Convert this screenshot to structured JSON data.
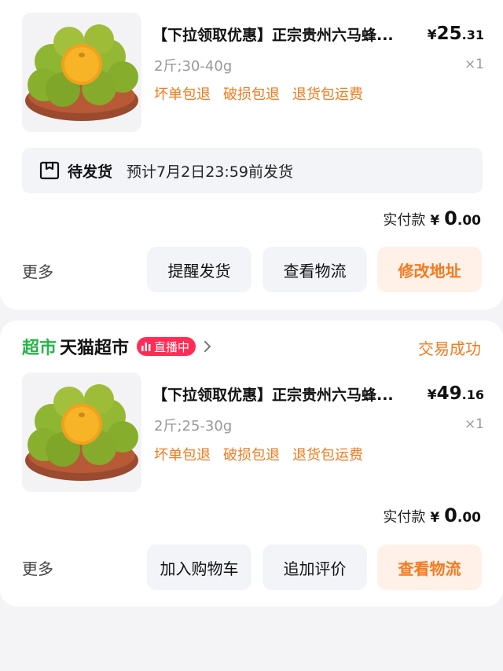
{
  "orders": [
    {
      "title": "【下拉领取优惠】正宗贵州六马蜂...",
      "price_symbol": "¥",
      "price_int": "25",
      "price_dec": ".31",
      "spec": "2斤;30-40g",
      "qty": "×1",
      "tags": [
        "坏单包退",
        "破损包退",
        "退货包运费"
      ],
      "ship_status": "待发货",
      "ship_eta": "预计7月2日23:59前发货",
      "paid_label": "实付款",
      "paid_symbol": "¥",
      "paid_int": "0",
      "paid_dec": ".00",
      "more": "更多",
      "buttons": [
        "提醒发货",
        "查看物流",
        "修改地址"
      ]
    },
    {
      "store_icon_text": "超市",
      "store_name": "天猫超市",
      "live_label": "直播中",
      "status": "交易成功",
      "title": "【下拉领取优惠】正宗贵州六马蜂...",
      "price_symbol": "¥",
      "price_int": "49",
      "price_dec": ".16",
      "spec": "2斤;25-30g",
      "qty": "×1",
      "tags": [
        "坏单包退",
        "破损包退",
        "退货包运费"
      ],
      "paid_label": "实付款",
      "paid_symbol": "¥",
      "paid_int": "0",
      "paid_dec": ".00",
      "more": "更多",
      "buttons": [
        "加入购物车",
        "追加评价",
        "查看物流"
      ]
    }
  ],
  "colors": {
    "accent": "#f47a1e",
    "store_green": "#29b34a",
    "live_red": "#ff2d55"
  }
}
